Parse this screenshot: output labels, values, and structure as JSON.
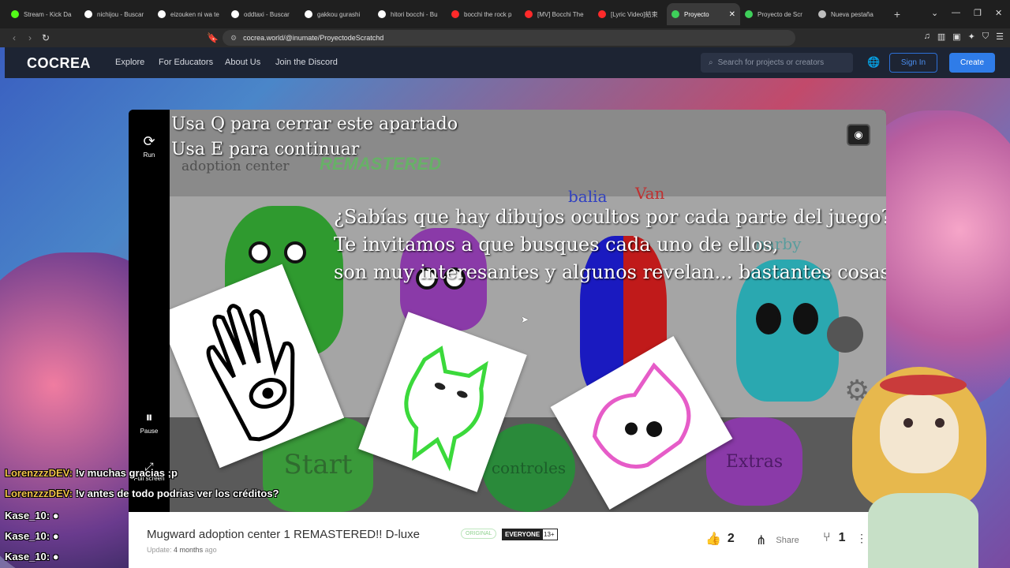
{
  "browser": {
    "tabs": [
      {
        "title": "Stream - Kick Da",
        "color": "#53fc18",
        "active": false
      },
      {
        "title": "nichijou - Buscar",
        "color": "#ffffff",
        "active": false
      },
      {
        "title": "eizouken ni wa te",
        "color": "#ffffff",
        "active": false
      },
      {
        "title": "oddtaxi - Buscar",
        "color": "#ffffff",
        "active": false
      },
      {
        "title": "gakkou gurashi",
        "color": "#ffffff",
        "active": false
      },
      {
        "title": "hitori bocchi - Bu",
        "color": "#ffffff",
        "active": false
      },
      {
        "title": "bocchi the rock p",
        "color": "#ff2a2a",
        "active": false
      },
      {
        "title": "[MV] Bocchi The",
        "color": "#ff2a2a",
        "active": false
      },
      {
        "title": "[Lyric Video]結束",
        "color": "#ff2a2a",
        "active": false
      },
      {
        "title": "Proyecto",
        "color": "#3ecf5a",
        "active": true
      },
      {
        "title": "Proyecto de Scr",
        "color": "#3ecf5a",
        "active": false
      },
      {
        "title": "Nueva pestaña",
        "color": "#bdbdbd",
        "active": false
      }
    ],
    "new_tab": "+",
    "url": "cocrea.world/@inumate/ProyectodeScratchd"
  },
  "site": {
    "logo": "COCREA",
    "nav": [
      "Explore",
      "For Educators",
      "About Us",
      "Join the Discord"
    ],
    "search_placeholder": "Search for projects or creators",
    "sign_in": "Sign In",
    "create": "Create"
  },
  "player": {
    "run_label": "Run",
    "pause_label": "Pause",
    "fullscreen_label": "Full screen",
    "hint_line1": "Usa Q para cerrar este apartado",
    "hint_line2": "Usa E para continuar",
    "ghost_title": "adoption center",
    "ghost_subtitle": "REMASTERED",
    "message": [
      "¿Sabías que hay dibujos ocultos por cada parte del juego?",
      "Te invitamos a que busques cada uno de ellos,",
      "son muy interesantes y algunos revelan... bastantes cosas"
    ],
    "char_labels": [
      "balia",
      "Van",
      "narby"
    ],
    "buttons": {
      "start": "Start",
      "controls": "controles",
      "extras": "Extras"
    }
  },
  "project": {
    "title": "Mugward adoption center 1 REMASTERED!! D-luxe",
    "badge_original": "ORIGINAL",
    "rating": "EVERYONE",
    "age": "13+",
    "update_label": "Update:",
    "update_value": "4 months",
    "update_suffix": "ago",
    "likes": "2",
    "share": "Share",
    "remixes": "1"
  },
  "chat": [
    {
      "user": "LorenzzzDEV:",
      "text": "!v muchas gracias ;p"
    },
    {
      "user": "LorenzzzDEV:",
      "text": "!v antes de todo podrias ver los créditos?"
    },
    {
      "user": "Kase_10:",
      "text": ""
    },
    {
      "user": "Kase_10:",
      "text": ""
    },
    {
      "user": "Kase_10:",
      "text": ""
    }
  ]
}
